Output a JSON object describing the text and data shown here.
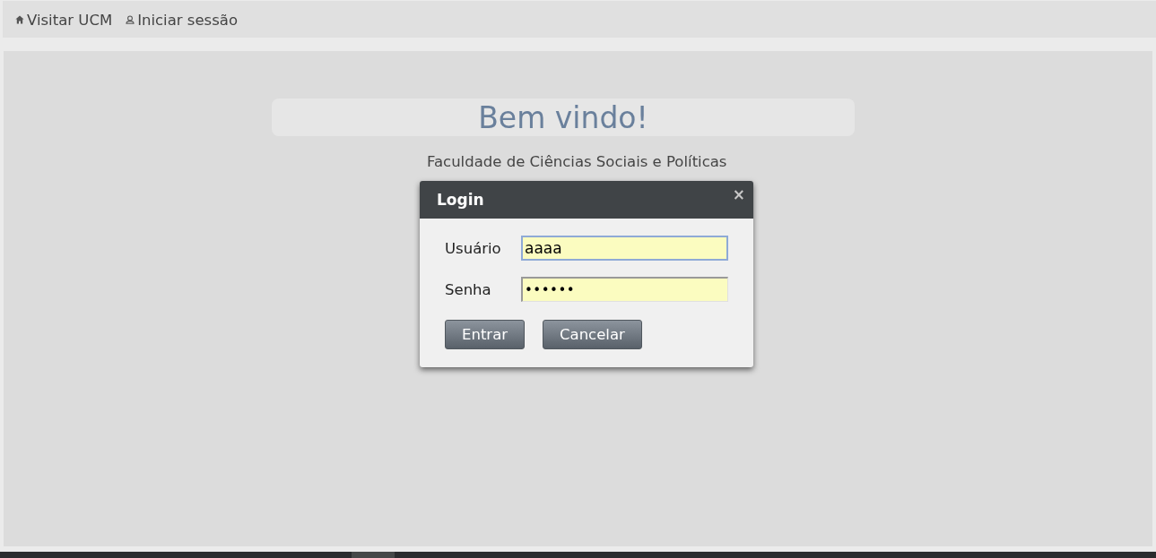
{
  "nav": {
    "links": [
      {
        "kind": "home",
        "label": "Visitar UCM"
      },
      {
        "kind": "user",
        "label": "Iniciar sessão"
      }
    ]
  },
  "welcome": {
    "title": "Bem vindo!",
    "subtitle": "Faculdade de Ciências Sociais e Políticas"
  },
  "dialog": {
    "title": "Login",
    "close": "×",
    "fields": [
      {
        "kind": "text",
        "label": "Usuário",
        "value": "aaaa",
        "focused": true
      },
      {
        "kind": "password",
        "label": "Senha",
        "value": "••••••",
        "focused": false
      }
    ],
    "buttons": [
      "Entrar",
      "Cancelar"
    ]
  }
}
